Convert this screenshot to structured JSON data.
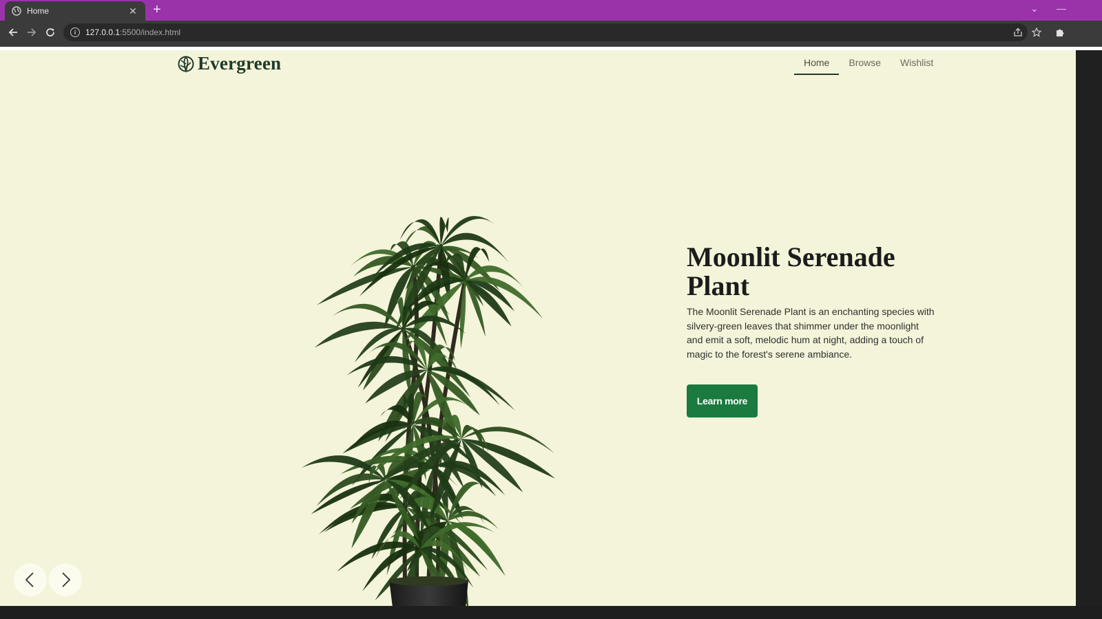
{
  "browser": {
    "tab_title": "Home",
    "tab_close": "✕",
    "new_tab": "+",
    "url_host": "127.0.0.1",
    "url_path": ":5500/index.html",
    "minimize": "—",
    "tab_search": "⌄"
  },
  "site": {
    "brand": "Evergreen",
    "nav": [
      {
        "label": "Home",
        "active": true
      },
      {
        "label": "Browse",
        "active": false
      },
      {
        "label": "Wishlist",
        "active": false
      }
    ]
  },
  "hero": {
    "title": "Moonlit Serenade Plant",
    "description": "The Moonlit Serenade Plant is an enchanting species with silvery-green leaves that shimmer under the moonlight and emit a soft, melodic hum at night, adding a touch of magic to the forest's serene ambiance.",
    "cta_label": "Learn more"
  },
  "colors": {
    "page_background": "#f4f4da",
    "brand_dark_green": "#1e3a2a",
    "cta_green": "#1b7a3e",
    "tab_strip": "#9a32aa"
  },
  "icons": {
    "logo": "leaf-globe-icon",
    "prev": "chevron-left-icon",
    "next": "chevron-right-icon"
  }
}
